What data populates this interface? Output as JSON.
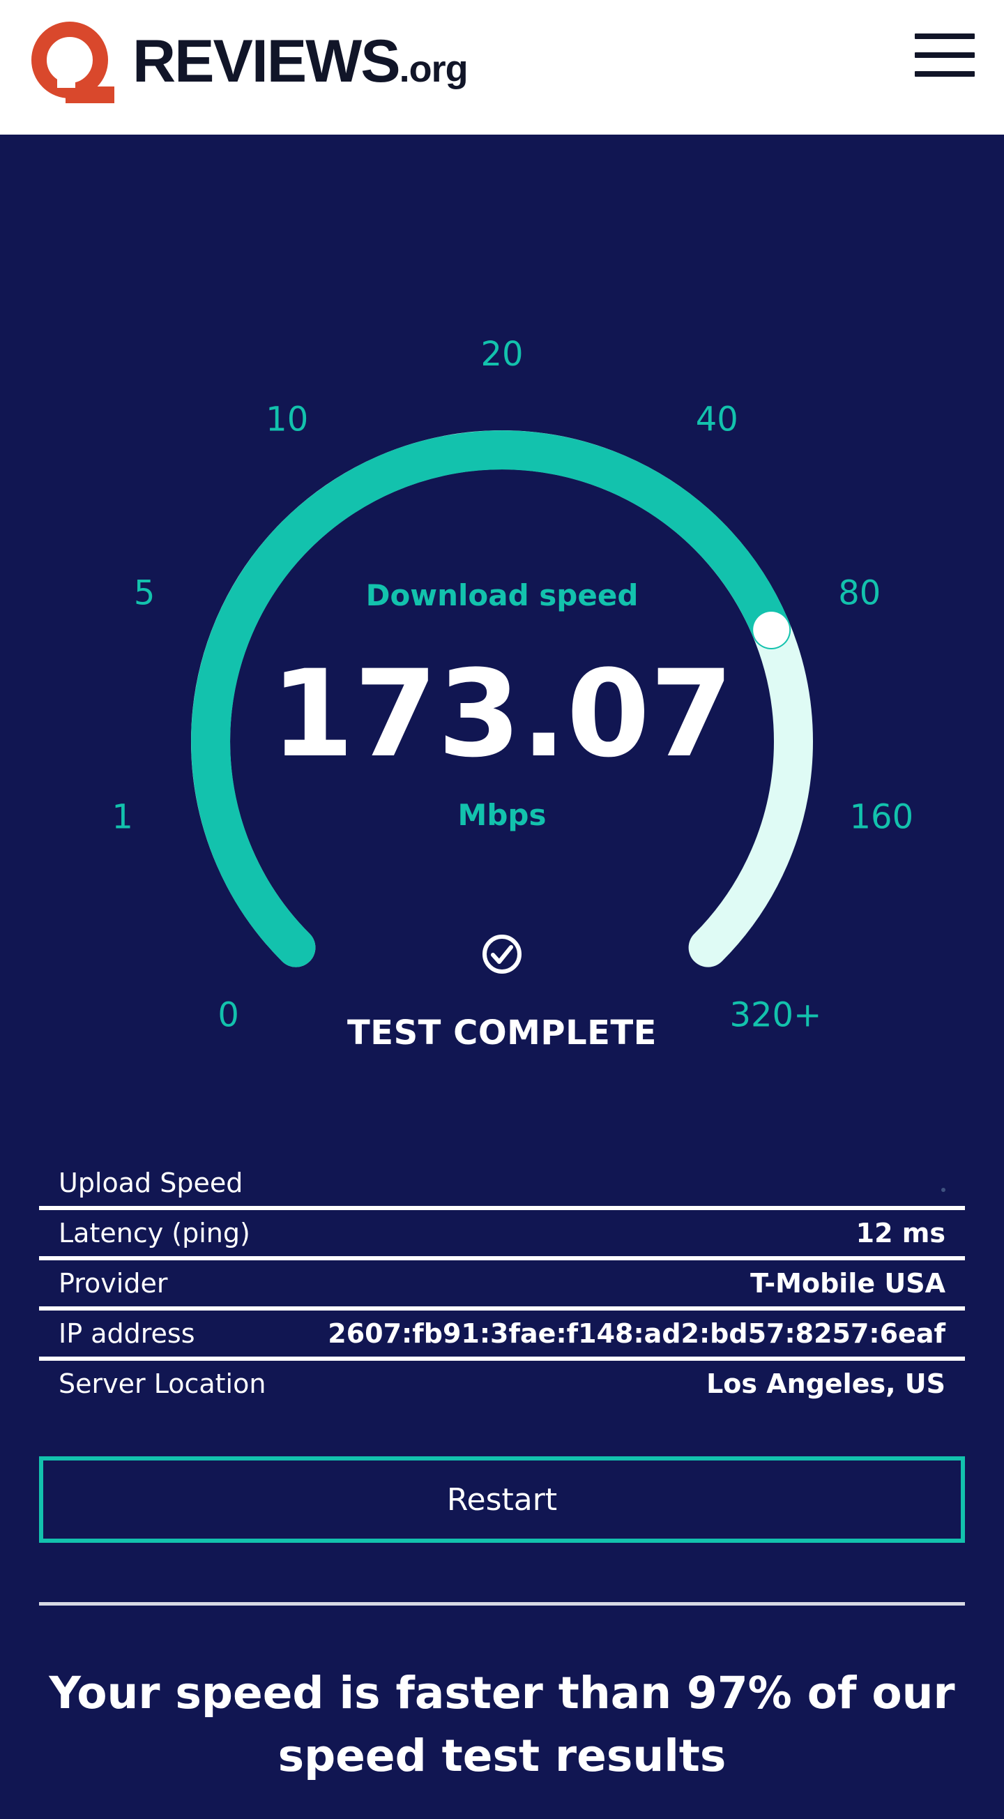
{
  "header": {
    "logo_main": "REVIEWS",
    "logo_tld": ".org",
    "logo_icon": "reviews-q-logo-icon",
    "menu_icon": "hamburger-menu-icon"
  },
  "gauge": {
    "label": "Download speed",
    "value": "173.07",
    "unit": "Mbps",
    "ticks": [
      "0",
      "1",
      "5",
      "10",
      "20",
      "40",
      "80",
      "160",
      "320+"
    ],
    "status_icon": "check-circle-icon",
    "status_text": "TEST COMPLETE",
    "colors": {
      "filled": "#13c2ad",
      "remaining": "#dffbf5",
      "tick_text": "#13c2ad",
      "background": "#111652"
    },
    "fill_fraction": 0.75
  },
  "results": [
    {
      "label": "Upload Speed",
      "value": ""
    },
    {
      "label": "Latency (ping)",
      "value": "12 ms"
    },
    {
      "label": "Provider",
      "value": "T-Mobile USA"
    },
    {
      "label": "IP address",
      "value": "2607:fb91:3fae:f148:ad2:bd57:8257:6eaf"
    },
    {
      "label": "Server Location",
      "value": "Los Angeles, US"
    }
  ],
  "restart_label": "Restart",
  "summary_text": "Your speed is faster than 97% of our speed test results"
}
